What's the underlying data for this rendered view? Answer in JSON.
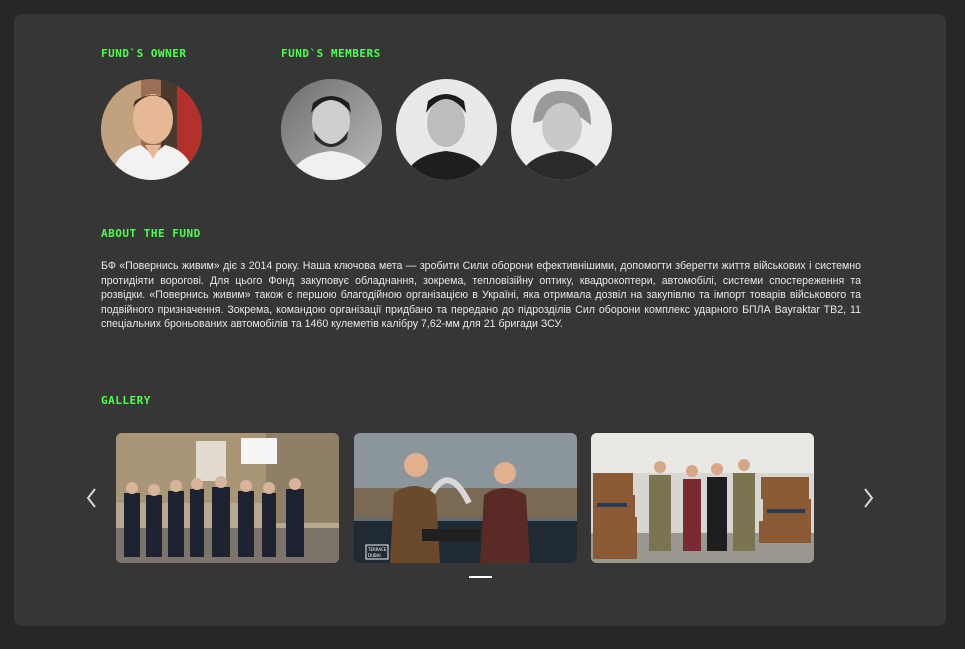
{
  "owner": {
    "title": "FUND`S OWNER",
    "photo_icon": "person-portrait-icon"
  },
  "members": {
    "title": "FUND`S MEMBERS",
    "photos": [
      "person-portrait-icon",
      "person-portrait-icon",
      "person-portrait-icon"
    ]
  },
  "about": {
    "title": "ABOUT THE FUND",
    "text": "БФ «Повернись живим» діє з 2014 року. Наша ключова мета — зробити Сили оборони ефективнішими, допомогти зберегти життя військових і системно протидіяти ворогові. Для цього Фонд закуповує обладнання, зокрема, тепловізійну оптику, квадрокоптери, автомобілі, системи спостереження та розвідки. «Повернись живим» також є першою благодійною організацією в Україні, яка отримала дозвіл на закупівлю та імпорт товарів військового та подвійного призначення. Зокрема, командою організації придбано та передано до підрозділів Сил оборони комплекс ударного БПЛА Bayraktar TB2, 11 спеціальних броньованих автомобілів та 1460 кулеметів калібру 7,62-мм для 21 бригади ЗСУ."
  },
  "gallery": {
    "title": "GALLERY",
    "prev_icon": "chevron-left-icon",
    "next_icon": "chevron-right-icon",
    "active_slide": 1,
    "slide_count": 1,
    "photo2_caption_line1": "TERRACE",
    "photo2_caption_line2": "DUBAI"
  },
  "colors": {
    "accent": "#4cff4c",
    "card_bg": "#363636",
    "page_bg": "#262626",
    "text": "#e8e8e8"
  }
}
